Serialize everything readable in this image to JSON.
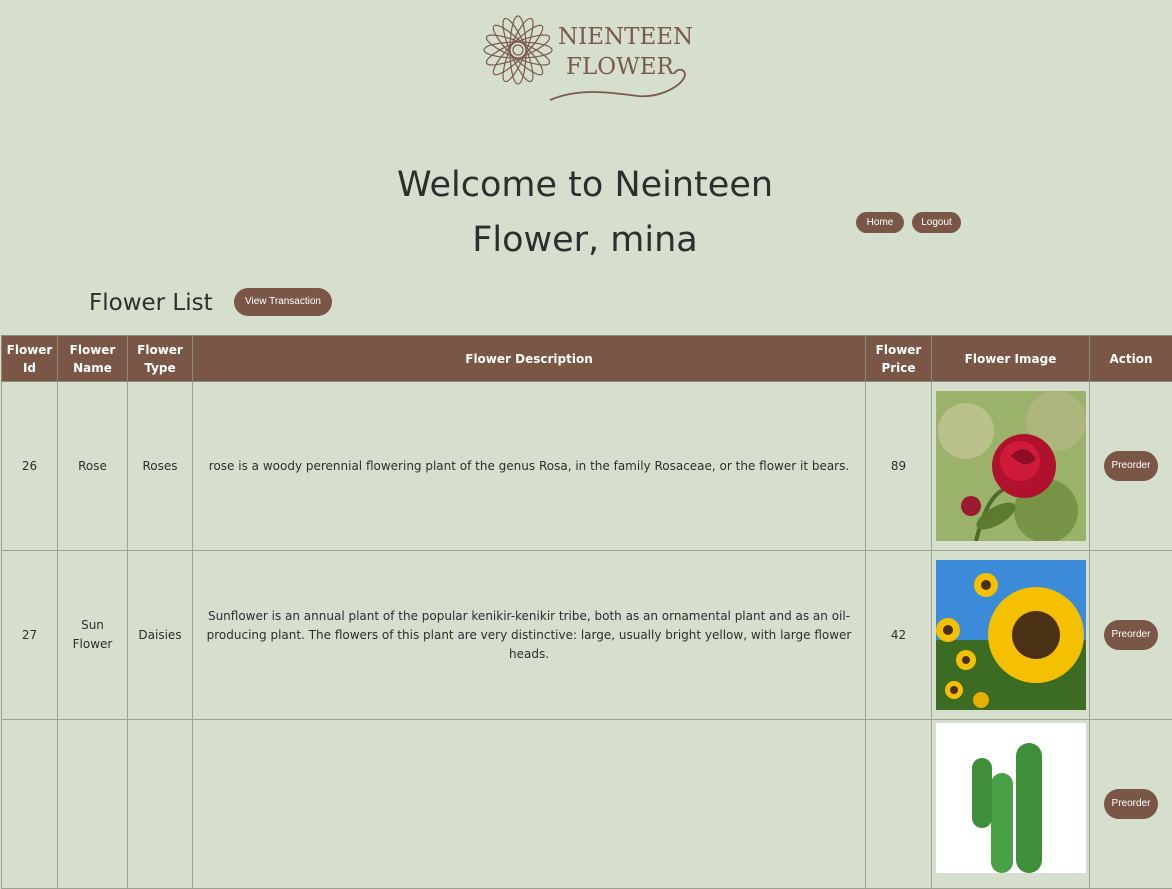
{
  "brand": {
    "line1": "NIENTEEN",
    "line2": "FLOWER"
  },
  "header": {
    "welcome": "Welcome to Neinteen Flower, mina",
    "home_label": "Home",
    "logout_label": "Logout"
  },
  "list": {
    "title": "Flower List",
    "view_transaction_label": "View Transaction"
  },
  "table": {
    "headers": [
      "Flower Id",
      "Flower Name",
      "Flower Type",
      "Flower Description",
      "Flower Price",
      "Flower Image",
      "Action"
    ],
    "rows": [
      {
        "id": "26",
        "name": "Rose",
        "type": "Roses",
        "description": "rose is a woody perennial flowering plant of the genus Rosa, in the family Rosaceae, or the flower it bears.",
        "price": "89",
        "image": "rose-photo",
        "action": "Preorder"
      },
      {
        "id": "27",
        "name": "Sun Flower",
        "type": "Daisies",
        "description": "Sunflower is an annual plant of the popular kenikir-kenikir tribe, both as an ornamental plant and as an oil-producing plant. The flowers of this plant are very distinctive: large, usually bright yellow, with large flower heads.",
        "price": "42",
        "image": "sunflower-photo",
        "action": "Preorder"
      },
      {
        "id": "",
        "name": "",
        "type": "",
        "description": "",
        "price": "",
        "image": "cactus-photo",
        "action": "Preorder"
      }
    ]
  },
  "colors": {
    "background": "#d6dfcd",
    "accent": "#7a5646",
    "logo": "#7a5a4c"
  }
}
